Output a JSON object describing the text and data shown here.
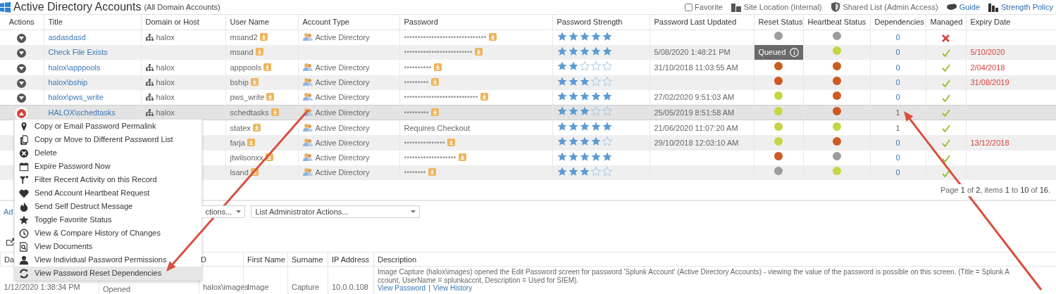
{
  "header": {
    "title": "Active Directory Accounts",
    "subtitle": "(All Domain Accounts)",
    "favorite": {
      "label": "Favorite",
      "checked": false
    },
    "info": [
      {
        "label": "Site Location (Internal)",
        "link": false
      },
      {
        "label": "Shared List (Admin Access)",
        "link": false
      },
      {
        "label": "Guide",
        "link": true
      },
      {
        "label": "Strength Policy",
        "link": true
      }
    ]
  },
  "table": {
    "columns": [
      "Actions",
      "Title",
      "Domain or Host",
      "User Name",
      "Account Type",
      "Password",
      "Password Strength",
      "Password Last Updated",
      "Reset Status",
      "Heartbeat Status",
      "Dependencies",
      "Managed",
      "Expiry Date"
    ],
    "rows": [
      {
        "expanded": false,
        "selected": false,
        "title": "asdasdasd",
        "domain": "halox",
        "user": "msand2",
        "account_type": "Active Directory",
        "password": "******************************",
        "stars": 5,
        "reset": {
          "kind": "dot",
          "color": "#9c9c9c"
        },
        "heartbeat": {
          "color": "#9c9c9c"
        },
        "dependencies": "0",
        "dependencies_link": true,
        "managed": false
      },
      {
        "expanded": false,
        "selected": false,
        "title": "Check File Exists",
        "user": "msand",
        "password": "*************************",
        "stars": 5,
        "last_updated": "5/08/2020 1:48:21 PM",
        "reset": {
          "kind": "badge",
          "label": "Queued"
        },
        "heartbeat": {
          "color": "#c6d544"
        },
        "dependencies": "0",
        "dependencies_link": true,
        "managed": true,
        "expiry": "5/10/2020"
      },
      {
        "expanded": false,
        "selected": false,
        "title": "halox\\apppools",
        "domain": "halox",
        "user": "apppools",
        "account_type": "Active Directory",
        "password": "**********",
        "stars": 2,
        "last_updated": "31/10/2018 11:03:55 AM",
        "reset": {
          "kind": "dot",
          "color": "#cc5b22"
        },
        "heartbeat": {
          "color": "#cc5b22"
        },
        "dependencies": "0",
        "dependencies_link": true,
        "managed": true,
        "expiry": "2/04/2018"
      },
      {
        "expanded": false,
        "selected": false,
        "title": "halox\\bship",
        "domain": "halox",
        "user": "bship",
        "account_type": "Active Directory",
        "password": "*********",
        "stars": 3,
        "reset": {
          "kind": "dot",
          "color": "#cc5b22"
        },
        "heartbeat": {
          "color": "#cc5b22"
        },
        "dependencies": "0",
        "dependencies_link": true,
        "managed": true,
        "expiry": "31/08/2019"
      },
      {
        "expanded": false,
        "selected": false,
        "title": "halox\\pws_write",
        "domain": "halox",
        "user": "pws_write",
        "account_type": "Active Directory",
        "password": "***************************",
        "stars": 5,
        "last_updated": "27/02/2020 9:51:03 AM",
        "reset": {
          "kind": "dot",
          "color": "#c6d544"
        },
        "heartbeat": {
          "color": "#cc5b22"
        },
        "dependencies": "0",
        "dependencies_link": true,
        "managed": true
      },
      {
        "expanded": true,
        "selected": true,
        "title": "HALOX\\schedtasks",
        "domain": "halox",
        "user": "schedtasks",
        "account_type": "Active Directory",
        "password": "*********",
        "stars": 3,
        "last_updated": "25/05/2019 8:51:58 AM",
        "reset": {
          "kind": "dot",
          "color": "#c6d544"
        },
        "heartbeat": {
          "color": "#cc5b22"
        },
        "dependencies": "1",
        "dependencies_link": false,
        "managed": true
      },
      {
        "selected": false,
        "user": "statex",
        "account_type": "Active Directory",
        "password": "Requires Checkout",
        "stars": 5,
        "last_updated": "21/06/2020 11:07:20 AM",
        "reset": {
          "kind": "dot",
          "color": "#c6d544"
        },
        "heartbeat": {
          "color": "#c6d544"
        },
        "dependencies": "1",
        "dependencies_link": false,
        "managed": true
      },
      {
        "selected": false,
        "user": "farja",
        "account_type": "Active Directory",
        "password": "***************",
        "stars": 4,
        "last_updated": "29/10/2018 12:03:10 AM",
        "reset": {
          "kind": "dot",
          "color": "#c6d544"
        },
        "heartbeat": {
          "color": "#cc5b22"
        },
        "dependencies": "0",
        "dependencies_link": true,
        "managed": true,
        "expiry": "13/12/2018"
      },
      {
        "selected": false,
        "user": "jtwilsonxx",
        "account_type": "Active Directory",
        "password": "*******************",
        "stars": 5,
        "reset": {
          "kind": "dot",
          "color": "#cc5b22"
        },
        "heartbeat": {
          "color": "#9c9c9c"
        },
        "dependencies": "0",
        "dependencies_link": true,
        "managed": true
      },
      {
        "selected": false,
        "user": "lsand",
        "account_type": "Active Directory",
        "password": "********",
        "stars": 3,
        "reset": {
          "kind": "dot",
          "color": "#9c9c9c"
        },
        "heartbeat": {
          "color": "#c6d544"
        },
        "dependencies": "0",
        "dependencies_link": true,
        "managed": true
      }
    ]
  },
  "pager": "Page **1** of **2**, items **1** to **10** of **16**.",
  "actions": {
    "link": "Ad",
    "dropdowns": [
      "ctions...",
      "List Administrator Actions..."
    ]
  },
  "audit": {
    "columns": [
      "Da",
      "D",
      "First Name",
      "Surname",
      "IP Address",
      "Description"
    ],
    "rows": [
      {
        "date": "1/12/2020 1:38:34 PM",
        "event": "Opened",
        "user_id": "halox\\images",
        "first_name": "Image",
        "surname": "Capture",
        "ip": "10.0.0.108",
        "description_lines": [
          "Image Capture (halox\\images) opened the Edit Password screen for password 'Splunk Account' (Active Directory Accounts) - viewing the value of the password is possible on this screen. (Title = Splunk A",
          "ccount, UserName = splunkaccnt, Description = Used for SIEM)."
        ],
        "links": [
          "View Password",
          "View History"
        ],
        "link_separator": "|"
      }
    ]
  },
  "menu": {
    "items": [
      {
        "label": "Copy or Email Password Permalink",
        "selected": false
      },
      {
        "label": "Copy or Move to Different Password List",
        "selected": false
      },
      {
        "label": "Delete",
        "selected": false
      },
      {
        "label": "Expire Password Now",
        "selected": false
      },
      {
        "label": "Filter Recent Activity on this Record",
        "selected": false
      },
      {
        "label": "Send Account Heartbeat Request",
        "selected": false
      },
      {
        "label": "Send Self Destruct Message",
        "selected": false
      },
      {
        "label": "Toggle Favorite Status",
        "selected": false
      },
      {
        "label": "View & Compare History of Changes",
        "selected": false
      },
      {
        "label": "View Documents",
        "selected": false
      },
      {
        "label": "View Individual Password Permissions",
        "selected": false
      },
      {
        "label": "View Password Reset Dependencies",
        "selected": true
      }
    ]
  }
}
